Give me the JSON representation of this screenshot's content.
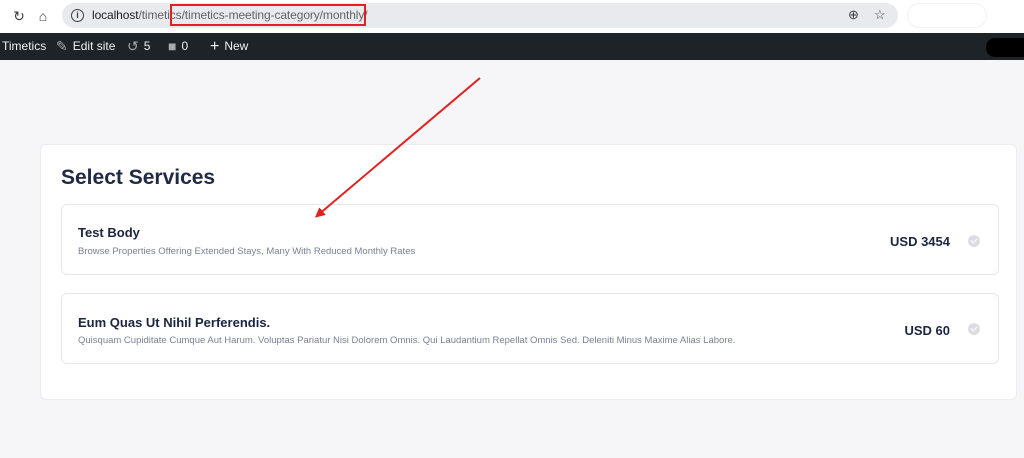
{
  "browser": {
    "url_host": "localhost",
    "url_path": "/timetics/timetics-meeting-category/monthly/",
    "icons": [
      "reload-icon",
      "home-icon",
      "info-icon",
      "zoom-icon",
      "star-icon"
    ]
  },
  "adminbar": {
    "site_name": "Timetics",
    "edit_site_label": "Edit site",
    "updates_count": "5",
    "comments_count": "0",
    "new_label": "New"
  },
  "main": {
    "title": "Select Services",
    "services": [
      {
        "name": "Test Body",
        "description": "Browse Properties Offering Extended Stays, Many With Reduced Monthly Rates",
        "price": "USD 3454"
      },
      {
        "name": "Eum Quas Ut Nihil Perferendis.",
        "description": "Quisquam Cupiditate Cumque Aut Harum. Voluptas Pariatur Nisi Dolorem Omnis. Qui Laudantium Repellat Omnis Sed. Deleniti Minus Maxime Alias Labore.",
        "price": "USD 60"
      }
    ]
  },
  "colors": {
    "admin_bar": "#1d2327",
    "annotation_red": "#e0211f",
    "heading": "#202a44",
    "page_bg": "#f6f6f9"
  }
}
